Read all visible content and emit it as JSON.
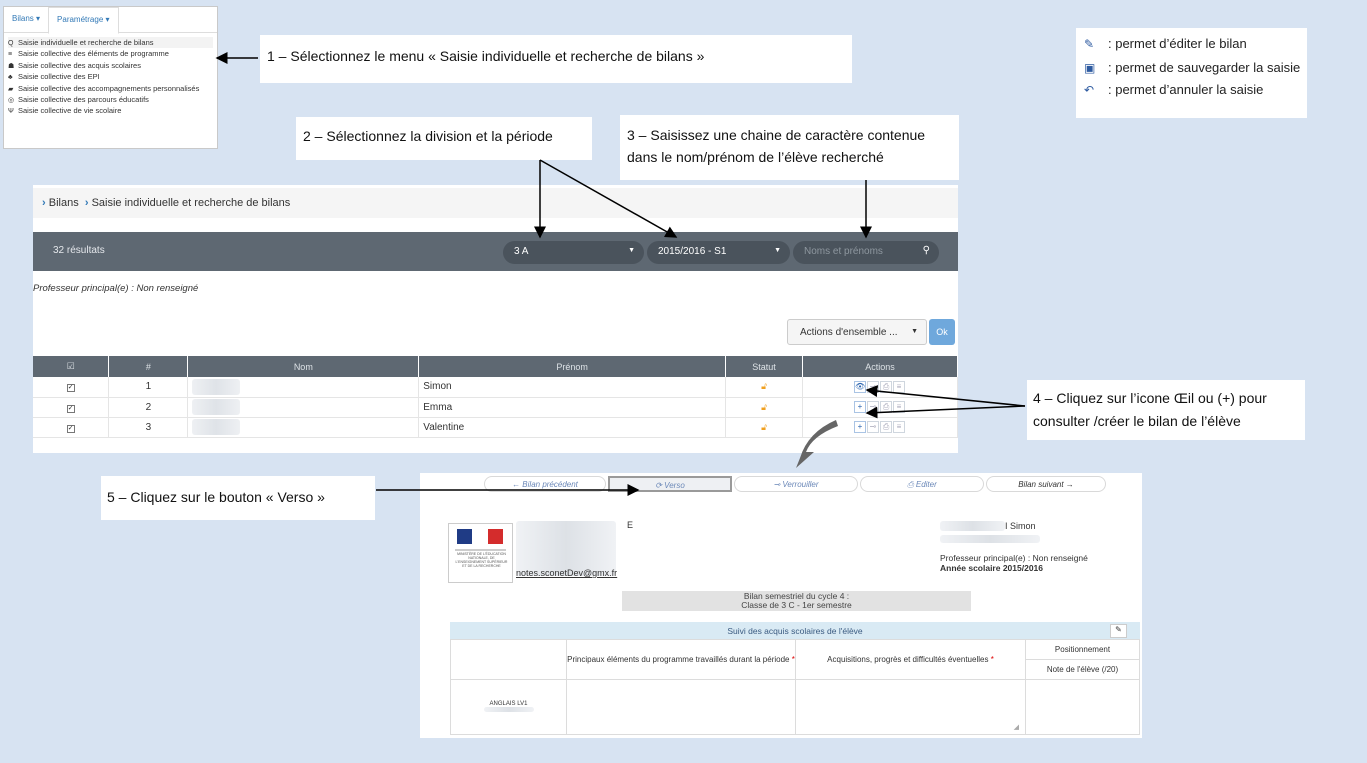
{
  "menu": {
    "tabs": [
      "Bilans ▾",
      "Paramétrage ▾"
    ],
    "items": [
      {
        "icon": "Q",
        "label": "Saisie individuelle et recherche de bilans"
      },
      {
        "icon": "≡",
        "label": "Saisie collective des éléments de programme"
      },
      {
        "icon": "☗",
        "label": "Saisie collective des acquis scolaires"
      },
      {
        "icon": "♣",
        "label": "Saisie collective des EPI"
      },
      {
        "icon": "▰",
        "label": "Saisie collective des accompagnements personnalisés"
      },
      {
        "icon": "◎",
        "label": "Saisie collective des parcours éducatifs"
      },
      {
        "icon": "Ψ",
        "label": "Saisie collective de vie scolaire"
      }
    ]
  },
  "callouts": {
    "c1": "1 – Sélectionnez le menu « Saisie individuelle et recherche de bilans »",
    "c2": "2 – Sélectionnez la division et la période",
    "c3a": "3 – Saisissez une chaine de caractère contenue",
    "c3b": "dans le nom/prénom de l’élève recherché",
    "c4a": "4 – Cliquez sur l’icone Œil ou (+) pour",
    "c4b": "consulter /créer le bilan de l’élève",
    "c5": "5 – Cliquez sur le bouton « Verso »"
  },
  "legend": [
    {
      "icon": "pencil-icon",
      "glyph": "✎",
      "text": ": permet d’éditer le bilan"
    },
    {
      "icon": "save-icon",
      "glyph": "▣",
      "text": ": permet de sauvegarder la saisie"
    },
    {
      "icon": "undo-icon",
      "glyph": "↶",
      "text": ": permet d’annuler la saisie"
    }
  ],
  "breadcrumb": {
    "items": [
      "Bilans",
      "Saisie individuelle et recherche de bilans"
    ]
  },
  "filterbar": {
    "results": "32 résultats",
    "division": "3 A",
    "period": "2015/2016 - S1",
    "search_placeholder": "Noms et prénoms"
  },
  "prof_principal": "Professeur principal(e) : Non renseigné",
  "bulk": {
    "actions_label": "Actions d'ensemble ...",
    "ok_label": "Ok"
  },
  "table": {
    "headers": [
      "☑",
      "#",
      "Nom",
      "Prénom",
      "Statut",
      "Actions"
    ],
    "rows": [
      {
        "num": "1",
        "prenom": "Simon",
        "action": "eye"
      },
      {
        "num": "2",
        "prenom": "Emma",
        "action": "plus"
      },
      {
        "num": "3",
        "prenom": "Valentine",
        "action": "plus"
      }
    ]
  },
  "verso": {
    "buttons": [
      "←  Bilan précédent",
      "⟳  Verso",
      "⊸  Verrouiller",
      "⎙  Editer",
      "Bilan suivant  →"
    ],
    "email": "notes.sconetDev@gmx.fr",
    "student_name": "I Simon",
    "school_initial": "E",
    "prof": "Professeur principal(e) : Non renseigné",
    "year": "Année scolaire 2015/2016",
    "sem_line1": "Bilan semestriel du cycle 4 :",
    "sem_line2": "Classe de 3 C - 1er semestre",
    "suivi_title": "Suivi des acquis scolaires de l'élève",
    "col_elements": "Principaux éléments du programme travaillés durant la période",
    "col_acquisitions": "Acquisitions, progrès et difficultés éventuelles",
    "col_position": "Positionnement",
    "col_note": "Note de l'élève (/20)",
    "subject": "ANGLAIS LV1",
    "ministere": "MINISTÈRE DE L'ÉDUCATION NATIONALE, DE L'ENSEIGNEMENT SUPÉRIEUR ET DE LA RECHERCHE"
  },
  "colors": {
    "accent": "#337ab7",
    "bar": "#5e6872",
    "background": "#d7e3f2"
  }
}
